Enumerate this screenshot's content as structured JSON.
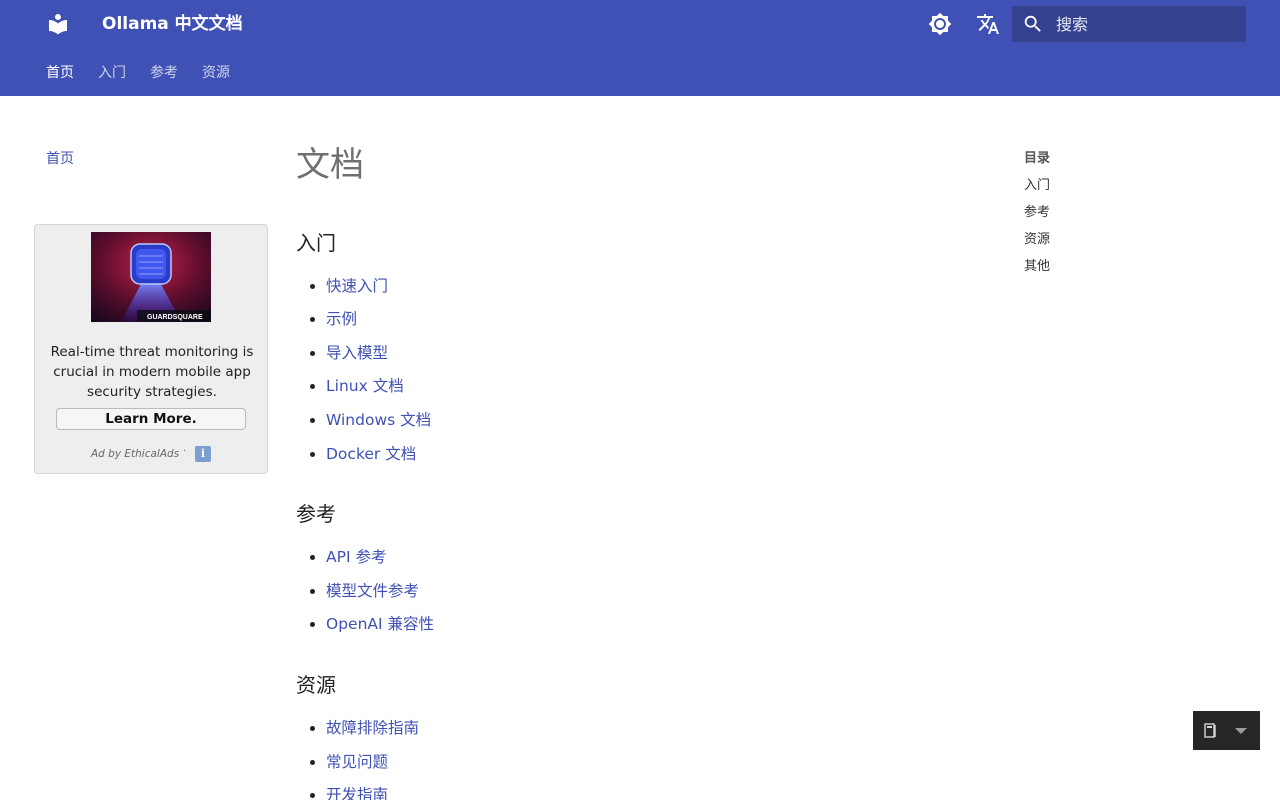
{
  "header": {
    "site_title": "Ollama 中文文档",
    "theme_toggle_icon": "brightness-icon",
    "language_icon": "translate-icon",
    "search": {
      "placeholder": "搜索",
      "value": ""
    },
    "colors": {
      "primary": "#4051b5",
      "search_bg": "#33418f"
    }
  },
  "tabs": [
    {
      "label": "首页",
      "active": true
    },
    {
      "label": "入门",
      "active": false
    },
    {
      "label": "参考",
      "active": false
    },
    {
      "label": "资源",
      "active": false
    }
  ],
  "sidebar": {
    "nav_link": "首页",
    "ad": {
      "image_brand": "GUARDSQUARE",
      "text": "Real-time threat monitoring is crucial in modern mobile app security strategies.",
      "button": "Learn More.",
      "by": "Ad by EthicalAds",
      "separator": "·",
      "info": "i"
    }
  },
  "main": {
    "title": "文档",
    "sections": [
      {
        "heading": "入门",
        "links": [
          "快速入门",
          "示例",
          "导入模型",
          "Linux 文档",
          "Windows 文档",
          "Docker 文档"
        ]
      },
      {
        "heading": "参考",
        "links": [
          "API 参考",
          "模型文件参考",
          "OpenAI 兼容性"
        ]
      },
      {
        "heading": "资源",
        "links": [
          "故障排除指南",
          "常见问题",
          "开发指南"
        ]
      }
    ]
  },
  "toc": {
    "title": "目录",
    "items": [
      "入门",
      "参考",
      "资源",
      "其他"
    ]
  },
  "version_widget": {
    "icon": "book-icon",
    "caret": "caret-down-icon"
  }
}
